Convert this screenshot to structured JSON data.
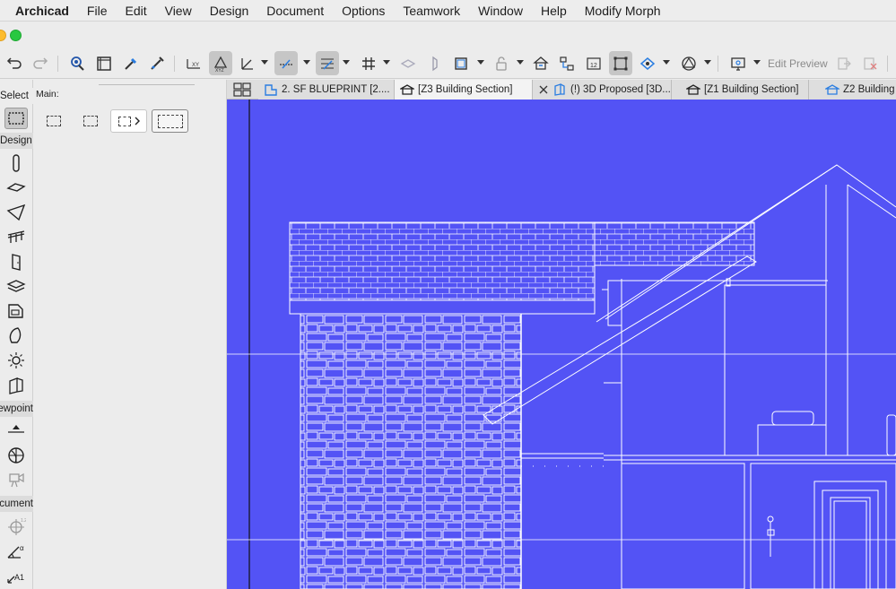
{
  "menubar": {
    "app_name": "Archicad",
    "items": [
      "File",
      "Edit",
      "View",
      "Design",
      "Document",
      "Options",
      "Teamwork",
      "Window",
      "Help",
      "Modify Morph"
    ]
  },
  "toolbar": {
    "edit_preview_label": "Edit Preview",
    "icons": [
      "undo-icon",
      "redo-icon",
      "find-select-icon",
      "frame-icon",
      "eyedropper-icon",
      "syringe-icon",
      "xy-coordinates-icon",
      "xyz-coordinates-icon",
      "angle-icon",
      "snap-guide-icon",
      "grid-snap-icon",
      "grid-icon",
      "layer-icon",
      "trace-icon",
      "floor-plan-icon",
      "lock-icon",
      "building-icon",
      "hierarchy-icon",
      "dimension-icon",
      "morph-icon",
      "view-icon",
      "shape-icon",
      "monitor-icon",
      "preview-export-icon",
      "preview-delete-icon"
    ]
  },
  "toolbox": {
    "select_label": "Select",
    "design_label": "Design",
    "viewpoint_label": "Viewpoint",
    "document_label": "Document"
  },
  "infobox": {
    "main_label": "Main:"
  },
  "tabs": [
    {
      "label": "2. SF BLUEPRINT [2....",
      "icon": "floor-plan-tab-icon"
    },
    {
      "label": "[Z3 Building Section]",
      "icon": "section-tab-icon"
    },
    {
      "label": "(!) 3D Proposed [3D...",
      "icon": "3d-tab-icon"
    },
    {
      "label": "[Z1 Building Section]",
      "icon": "section-tab-icon"
    },
    {
      "label": "Z2 Building",
      "icon": "section-tab-icon"
    }
  ],
  "colors": {
    "canvas_bg": "#5353f5",
    "drawing_line": "#ffffff",
    "menubar_bg": "#ededed",
    "active_tab_bg": "#f3f3f3"
  }
}
